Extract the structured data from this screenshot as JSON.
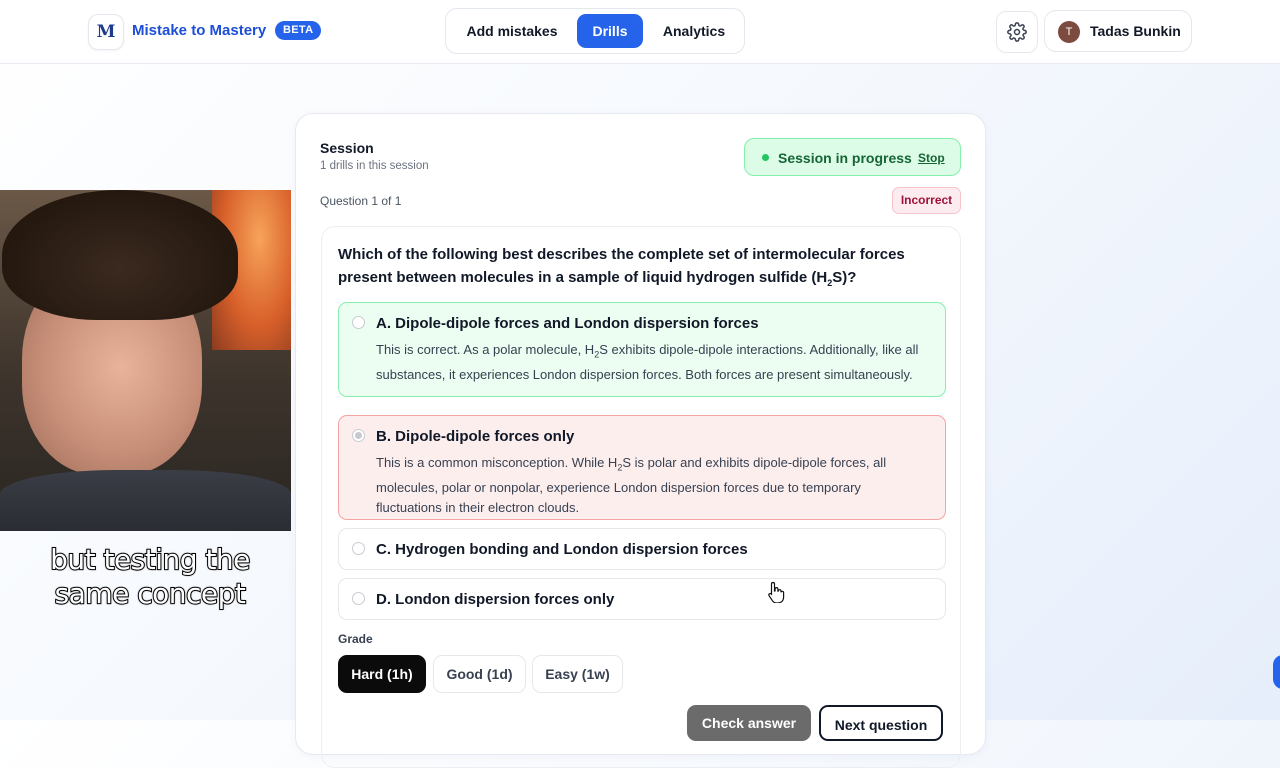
{
  "header": {
    "logo_letter": "M",
    "brand": "Mistake to Mastery",
    "badge": "BETA",
    "tabs": [
      {
        "label": "Add mistakes",
        "active": false
      },
      {
        "label": "Drills",
        "active": true
      },
      {
        "label": "Analytics",
        "active": false
      }
    ],
    "settings_icon": "gear-icon",
    "user": {
      "initial": "T",
      "name": "Tadas Bunkin"
    }
  },
  "session": {
    "title": "Session",
    "subtitle": "1 drills in this session",
    "status": "Session in progress",
    "stop_label": "Stop",
    "question_counter": "Question 1 of 1",
    "result_badge": "Incorrect"
  },
  "question": {
    "text_prefix": "Which of the following best describes the complete set of intermolecular forces present between molecules in a sample of liquid hydrogen sulfide (H",
    "text_sub": "2",
    "text_suffix": "S)?",
    "options": [
      {
        "label": "A. Dipole-dipole forces and London dispersion forces",
        "state": "correct",
        "explanation_prefix": "This is correct. As a polar molecule, H",
        "explanation_sub": "2",
        "explanation_suffix": "S exhibits dipole-dipole interactions. Additionally, like all substances, it experiences London dispersion forces. Both forces are present simultaneously."
      },
      {
        "label": "B. Dipole-dipole forces only",
        "state": "selected-incorrect",
        "explanation_prefix": "This is a common misconception. While H",
        "explanation_sub": "2",
        "explanation_suffix": "S is polar and exhibits dipole-dipole forces, all molecules, polar or nonpolar, experience London dispersion forces due to temporary fluctuations in their electron clouds."
      },
      {
        "label": "C. Hydrogen bonding and London dispersion forces",
        "state": "neutral"
      },
      {
        "label": "D. London dispersion forces only",
        "state": "neutral"
      }
    ]
  },
  "grade": {
    "label": "Grade",
    "buttons": [
      "Hard (1h)",
      "Good (1d)",
      "Easy (1w)"
    ],
    "selected": "Hard (1h)"
  },
  "actions": {
    "check_label": "Check answer",
    "next_label": "Next question"
  },
  "overlay": {
    "caption_line1": "but testing the",
    "caption_line2": "same concept"
  },
  "colors": {
    "accent": "#2563eb",
    "correct_bg": "#ecfdf1",
    "wrong_bg": "#fdeeee",
    "status_green": "#166534"
  }
}
